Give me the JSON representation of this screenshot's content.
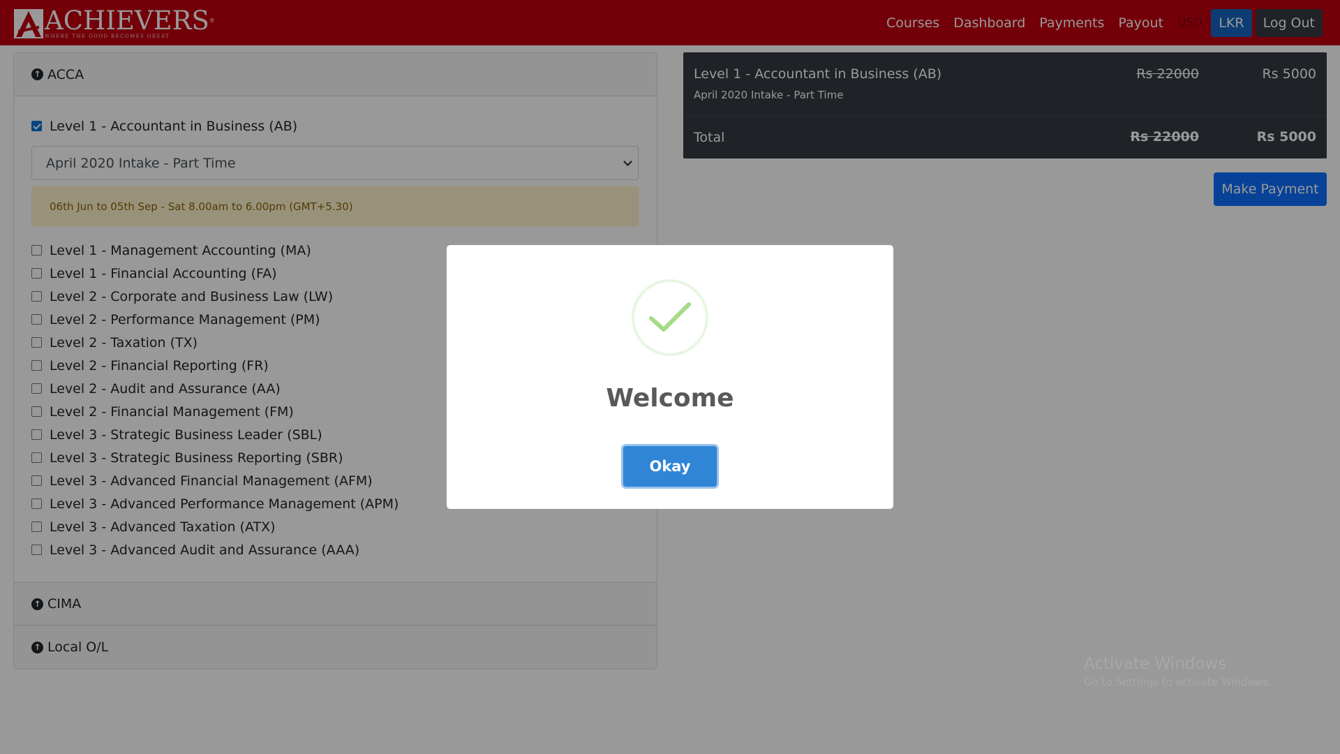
{
  "brand": {
    "name": "ACHIEVERS",
    "registered": "®",
    "tagline": "WHERE THE GOOD BECOMES GREAT"
  },
  "nav": {
    "courses": "Courses",
    "dashboard": "Dashboard",
    "payments": "Payments",
    "payout": "Payout",
    "usd": "USD",
    "lkr": "LKR",
    "logout": "Log Out"
  },
  "accordion": {
    "acca": {
      "title": "ACCA",
      "selected_course": "Level 1 - Accountant in Business (AB)",
      "intake_value": "April 2020 Intake - Part Time",
      "schedule": "06th Jun to 05th Sep - Sat 8.00am to 6.00pm (GMT+5.30)",
      "courses": [
        "Level 1 - Management Accounting (MA)",
        "Level 1 - Financial Accounting (FA)",
        "Level 2 - Corporate and Business Law (LW)",
        "Level 2 - Performance Management (PM)",
        "Level 2 - Taxation (TX)",
        "Level 2 - Financial Reporting (FR)",
        "Level 2 - Audit and Assurance (AA)",
        "Level 2 - Financial Management (FM)",
        "Level 3 - Strategic Business Leader (SBL)",
        "Level 3 - Strategic Business Reporting (SBR)",
        "Level 3 - Advanced Financial Management (AFM)",
        "Level 3 - Advanced Performance Management (APM)",
        "Level 3 - Advanced Taxation (ATX)",
        "Level 3 - Advanced Audit and Assurance (AAA)"
      ]
    },
    "cima": {
      "title": "CIMA"
    },
    "local_ol": {
      "title": "Local O/L"
    }
  },
  "cart": {
    "item": {
      "title": "Level 1 - Accountant in Business (AB)",
      "subtitle": "April 2020 Intake - Part Time",
      "old_price": "Rs 22000",
      "new_price": "Rs 5000"
    },
    "total": {
      "label": "Total",
      "old_price": "Rs 22000",
      "new_price": "Rs 5000"
    },
    "pay_button": "Make Payment"
  },
  "watermark": {
    "title": "Activate Windows",
    "subtitle": "Go to Settings to activate Windows."
  },
  "modal": {
    "title": "Welcome",
    "button": "Okay",
    "icon": "success-check-icon"
  },
  "colors": {
    "navbar": "#c00010",
    "primary": "#0d6efd",
    "lkr_active": "#1565c0",
    "dark": "#343a40",
    "success": "#a5dc86",
    "modal_button": "#3085d6"
  }
}
